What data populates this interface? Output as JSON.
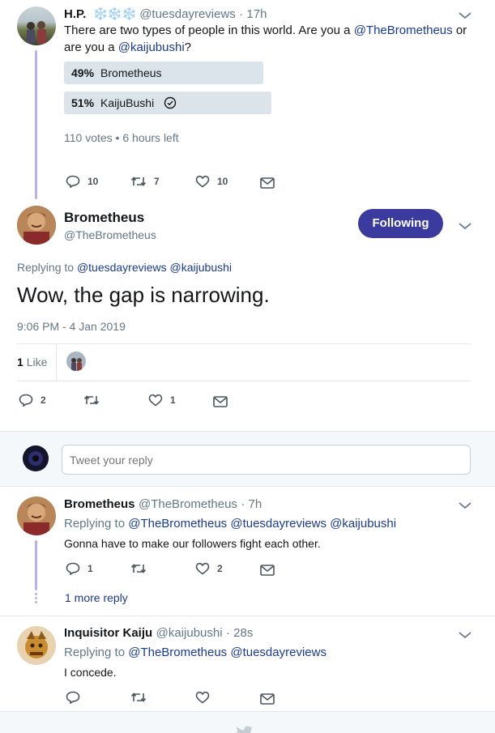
{
  "tweet1": {
    "name": "H.P.",
    "emoji": "❄️❄️❄️",
    "handle": "@tuesdayreviews",
    "time": "· 17h",
    "text_pre": "There are two types of people in this world. Are you a ",
    "mention1": "@TheBrometheus",
    "text_mid": " or are you a ",
    "mention2": "@kaijubushi",
    "text_end": "?",
    "poll": {
      "option1": {
        "pct": "49%",
        "label": "Brometheus",
        "value": 49
      },
      "option2": {
        "pct": "51%",
        "label": "KaijuBushi",
        "value": 51
      },
      "meta": "110 votes • 6 hours left"
    },
    "replies": "10",
    "retweets": "7",
    "likes": "10"
  },
  "main": {
    "name": "Brometheus",
    "handle": "@TheBrometheus",
    "follow_label": "Following",
    "replying_to_label": "Replying to",
    "replying_to_1": "@tuesdayreviews",
    "replying_to_2": "@kaijubushi",
    "text": "Wow, the gap is narrowing.",
    "timestamp": "9:06 PM - 4 Jan 2019",
    "likes_count": "1",
    "likes_label": "Like",
    "replies": "2",
    "retweets": "",
    "likes": "1"
  },
  "reply_box": {
    "placeholder": "Tweet your reply"
  },
  "reply1": {
    "name": "Brometheus",
    "handle": "@TheBrometheus",
    "time": "· 7h",
    "replying_to_label": "Replying to",
    "replying_to_1": "@TheBrometheus",
    "replying_to_2": "@tuesdayreviews",
    "replying_to_3": "@kaijubushi",
    "text": "Gonna have to make our followers fight each other.",
    "replies": "1",
    "retweets": "",
    "likes": "2",
    "more_replies": "1 more reply"
  },
  "reply2": {
    "name": "Inquisitor Kaiju",
    "handle": "@kaijubushi",
    "time": "· 28s",
    "replying_to_label": "Replying to",
    "replying_to_1": "@TheBrometheus",
    "replying_to_2": "@tuesdayreviews",
    "text": "I concede.",
    "replies": "",
    "retweets": "",
    "likes": ""
  },
  "colors": {
    "accent": "#3b3a9e",
    "link": "#1b3a8c",
    "thread_line": "#b9b2e3",
    "poll_bar": "#dbe3eb"
  }
}
